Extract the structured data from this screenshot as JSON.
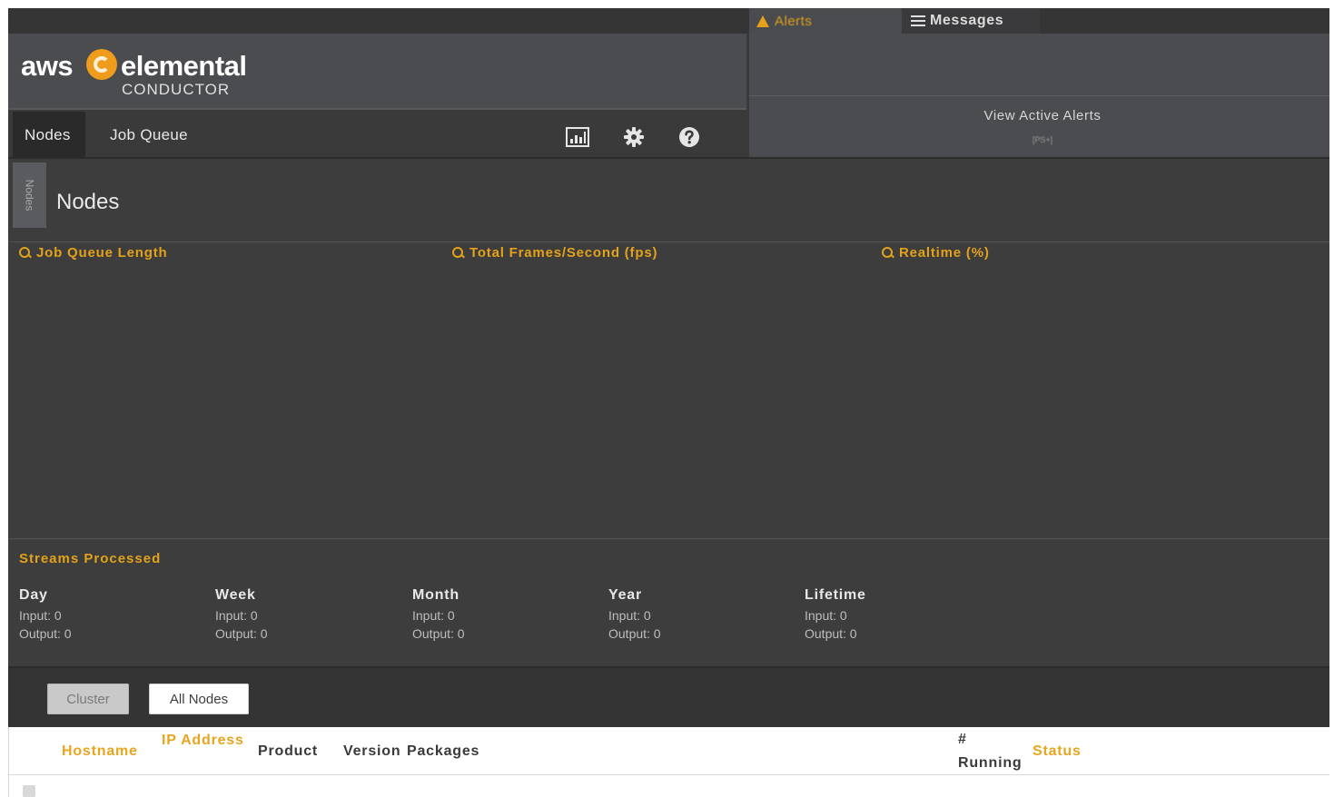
{
  "app": {
    "logo_aws": "aws",
    "logo_elemental": "elemental",
    "logo_conductor": "CONDUCTOR",
    "brand_color": "#ef9b1c",
    "accent_color": "#e3a21a"
  },
  "topbar": {
    "alerts_label": "Alerts",
    "alerts_icon": "warning-icon",
    "messages_label": "Messages",
    "messages_icon": "list-icon"
  },
  "alert_panel": {
    "view_active_alerts": "View Active Alerts",
    "subtext": "[PS+]"
  },
  "nav": {
    "items": [
      {
        "label": "Nodes",
        "active": true
      },
      {
        "label": "Job Queue",
        "active": false
      }
    ],
    "icons": [
      "chart-icon",
      "gear-icon",
      "help-icon"
    ]
  },
  "side_tab": {
    "label": "Nodes"
  },
  "page": {
    "title": "Nodes"
  },
  "graphs": [
    {
      "title": "Job Queue Length"
    },
    {
      "title": "Total Frames/Second (fps)"
    },
    {
      "title": "Realtime (%)"
    }
  ],
  "streams": {
    "title": "Streams Processed",
    "periods": [
      {
        "label": "Day",
        "input": "Input: 0",
        "output": "Output: 0"
      },
      {
        "label": "Week",
        "input": "Input: 0",
        "output": "Output: 0"
      },
      {
        "label": "Month",
        "input": "Input: 0",
        "output": "Output: 0"
      },
      {
        "label": "Year",
        "input": "Input: 0",
        "output": "Output: 0"
      },
      {
        "label": "Lifetime",
        "input": "Input: 0",
        "output": "Output: 0"
      }
    ]
  },
  "filters": {
    "cluster": "Cluster",
    "all_nodes": "All Nodes"
  },
  "table": {
    "columns": {
      "hostname": "Hostname",
      "ip_address": "IP Address",
      "product": "Product",
      "version": "Version",
      "packages": "Packages",
      "running_hash": "#",
      "running": "Running",
      "status": "Status"
    }
  }
}
